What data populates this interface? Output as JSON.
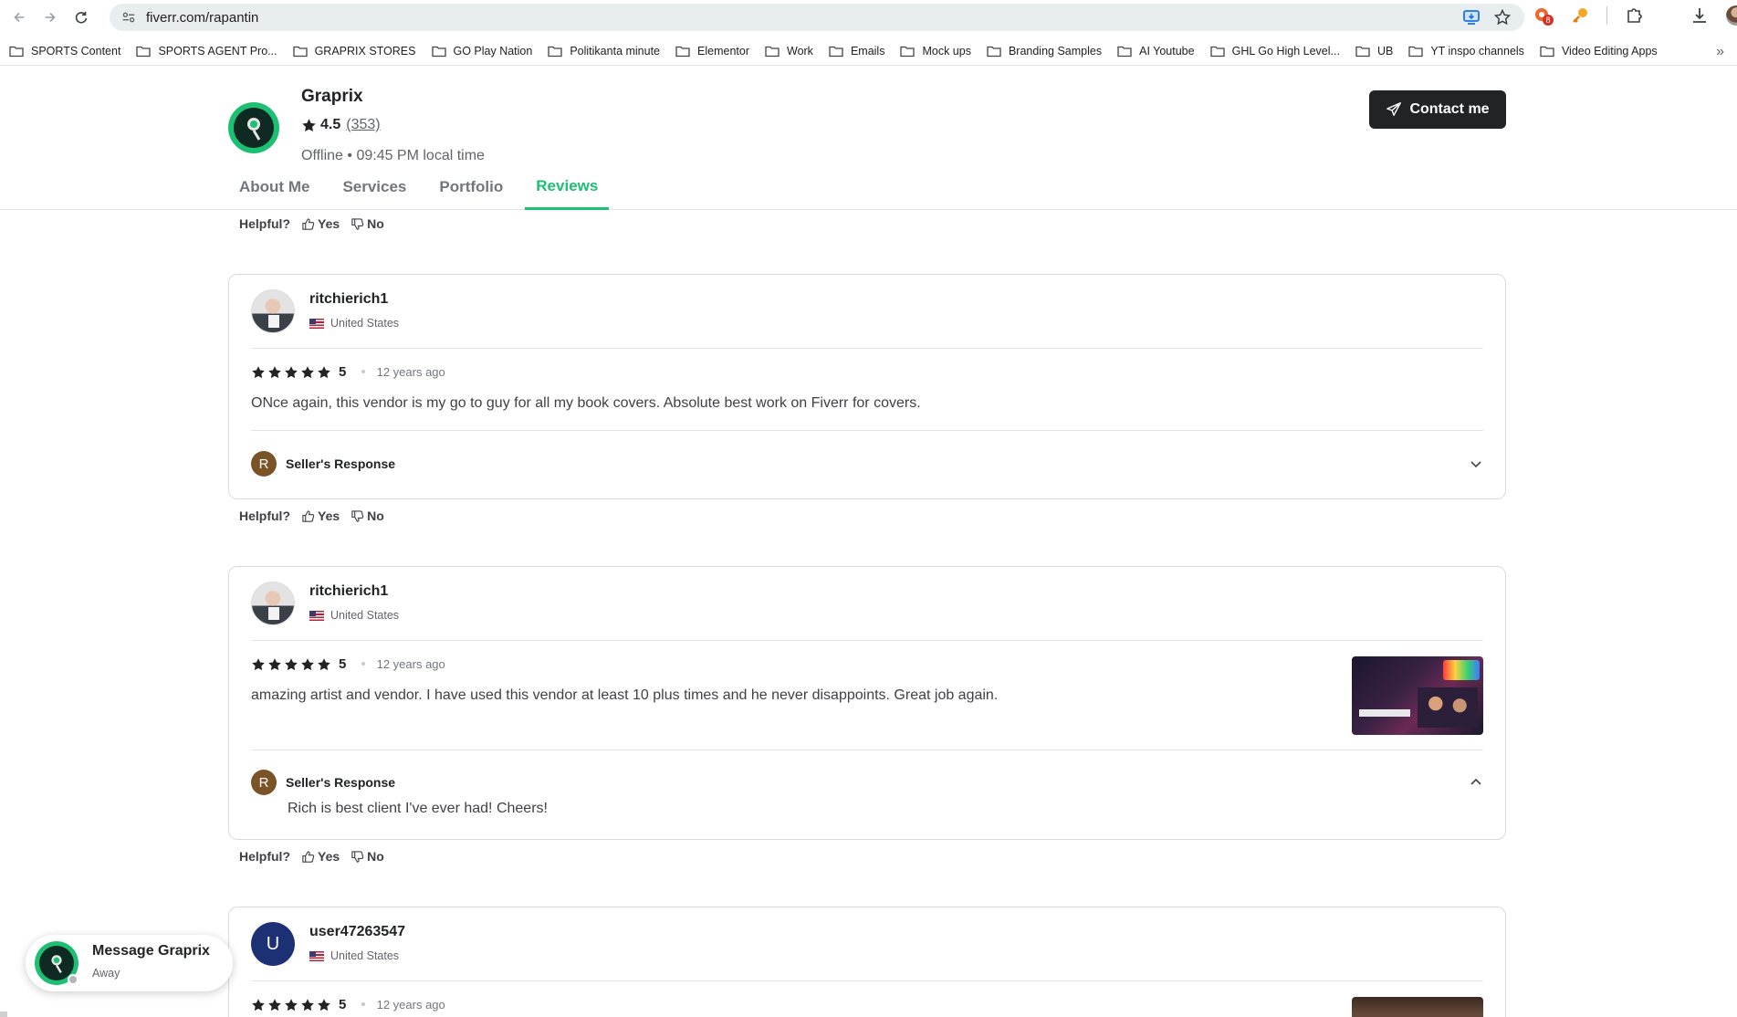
{
  "browser": {
    "url": "fiverr.com/rapantin",
    "extension_badge": "8",
    "bookmarks": [
      "SPORTS Content",
      "SPORTS AGENT Pro...",
      "GRAPRIX STORES",
      "GO Play Nation",
      "Politikanta minute",
      "Elementor",
      "Work",
      "Emails",
      "Mock ups",
      "Branding Samples",
      "AI Youtube",
      "GHL Go High Level...",
      "UB",
      "YT inspo channels",
      "Video Editing Apps"
    ]
  },
  "seller": {
    "name": "Graprix",
    "rating": "4.5",
    "review_count": "(353)",
    "status": "Offline • 09:45 PM local time",
    "contact_label": "Contact me"
  },
  "tabs": [
    "About Me",
    "Services",
    "Portfolio",
    "Reviews"
  ],
  "active_tab": "Reviews",
  "helpful": {
    "label": "Helpful?",
    "yes": "Yes",
    "no": "No"
  },
  "reviews": [
    {
      "user": "ritchierich1",
      "country": "United States",
      "rating": "5",
      "time_ago": "12 years ago",
      "text": "ONce again, this vendor is my go to guy for all my book covers. Absolute best work on Fiverr for covers.",
      "response_label": "Seller's Response",
      "response_initial": "R",
      "response_expanded": false
    },
    {
      "user": "ritchierich1",
      "country": "United States",
      "rating": "5",
      "time_ago": "12 years ago",
      "text": "amazing artist and vendor. I have used this vendor at least 10 plus times and he never disappoints. Great job again.",
      "response_label": "Seller's Response",
      "response_initial": "R",
      "response_expanded": true,
      "response_text": "Rich is best client I've ever had! Cheers!"
    },
    {
      "user": "user47263547",
      "avatar_initial": "U",
      "country": "United States",
      "rating": "5",
      "time_ago": "12 years ago"
    }
  ],
  "message_widget": {
    "title": "Message Graprix",
    "status": "Away"
  },
  "colors": {
    "brand_green": "#1dbf73",
    "dark": "#222325",
    "muted": "#74767e"
  }
}
